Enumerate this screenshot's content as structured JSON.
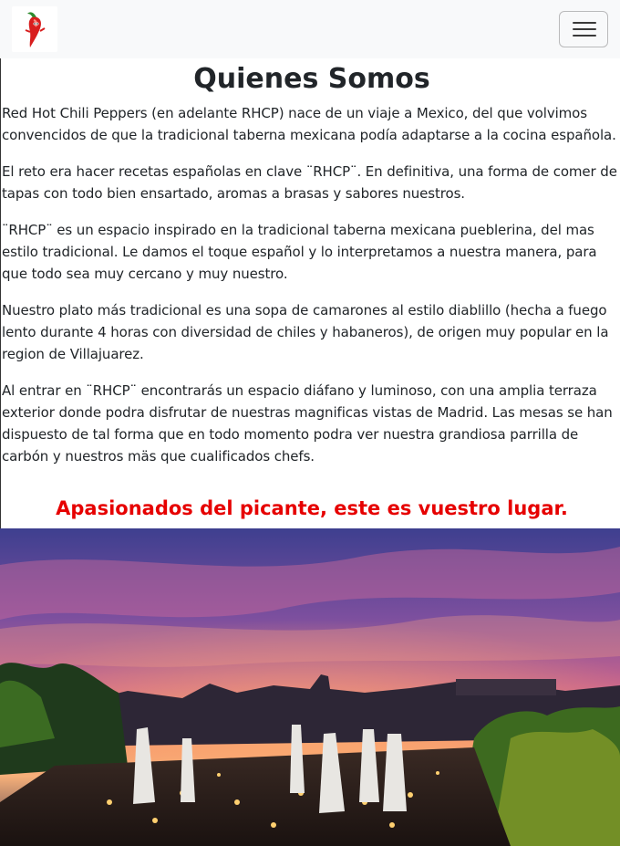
{
  "navbar": {
    "logo_icon": "chili-pepper-logo",
    "menu_icon": "hamburger-menu-icon"
  },
  "about": {
    "title": "Quienes Somos",
    "paragraphs": [
      "Red Hot Chili Peppers (en adelante RHCP) nace de un viaje a Mexico, del que volvimos convencidos de que la tradicional taberna mexicana podía adaptarse a la cocina española.",
      "El reto era hacer recetas españolas en clave ¨RHCP¨. En definitiva, una forma de comer de tapas con todo bien ensartado, aromas a brasas y sabores nuestros.",
      "¨RHCP¨ es un espacio inspirado en la tradicional taberna mexicana pueblerina, del mas estilo tradicional. Le damos el toque español y lo interpretamos a nuestra manera, para que todo sea muy cercano y muy nuestro.",
      "Nuestro plato más tradicional es una sopa de camarones al estilo diablillo (hecha a fuego lento durante 4 horas con diversidad de chiles y habaneros), de origen muy popular en la region de Villajuarez.",
      "Al entrar en ¨RHCP¨ encontrarás un espacio diáfano y luminoso, con una amplia terraza exterior donde podra disfrutar de nuestras magnificas vistas de Madrid. Las mesas se han dispuesto de tal forma que en todo momento podra ver nuestra grandiosa parrilla de carbón y nuestros mäs que cualificados chefs."
    ],
    "tagline": "Apasionados del picante, este es vuestro lugar.",
    "tagline_color": "#e60000"
  },
  "hero_image": {
    "subject": "rooftop-terrace-sunset-madrid-photo"
  }
}
